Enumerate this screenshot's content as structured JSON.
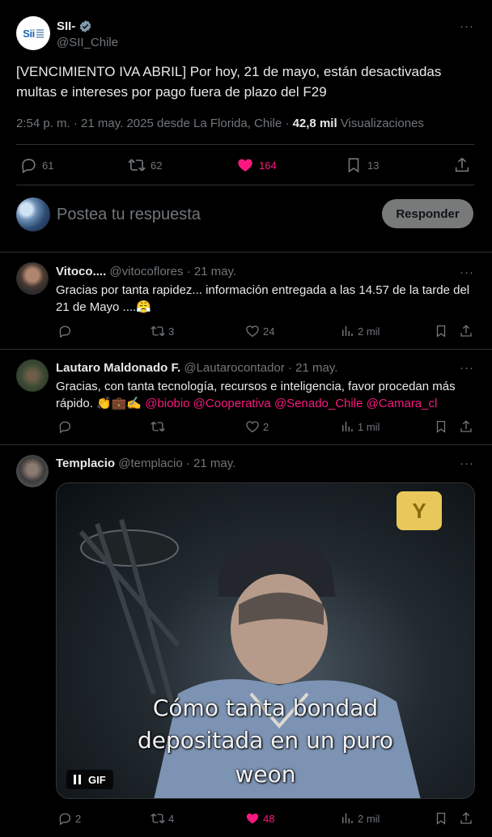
{
  "tweet": {
    "author_name": "SII-",
    "author_handle": "@SII_Chile",
    "logo_text": "Sii",
    "text": "[VENCIMIENTO IVA ABRIL] Por hoy, 21 de mayo, están desactivadas multas e intereses por pago fuera de plazo del F29",
    "meta_time": "2:54 p. m. · 21 may. 2025 desde La Florida, Chile · ",
    "views_count": "42,8 mil",
    "views_label": "Visualizaciones",
    "replies": "61",
    "retweets": "62",
    "likes": "164",
    "bookmarks": "13",
    "more_icon": "···"
  },
  "composer": {
    "placeholder": "Postea tu respuesta",
    "button_label": "Responder"
  },
  "replies": [
    {
      "name": "Vitoco....",
      "handle": "@vitocoflores",
      "date": "· 21 may.",
      "text": "Gracias por tanta rapidez... información entregada a las 14.57 de la tarde del 21 de Mayo ....😤",
      "replies": "",
      "retweets": "3",
      "likes": "24",
      "views": "2 mil"
    },
    {
      "name": "Lautaro Maldonado F.",
      "handle": "@Lautarocontador",
      "date": "· 21 may.",
      "text_plain": "Gracias, con tanta tecnología, recursos e inteligencia, favor procedan más rápido. 👏💼✍️ ",
      "mentions": "@biobio @Cooperativa @Senado_Chile @Camara_cl",
      "replies": "",
      "retweets": "",
      "likes": "2",
      "views": "1 mil"
    },
    {
      "name": "Templacio",
      "handle": "@templacio",
      "date": "· 21 may.",
      "gif_caption_1": "Cómo tanta bondad",
      "gif_caption_2": "depositada en un puro",
      "gif_caption_3": "weon",
      "gif_badge": "GIF",
      "replies": "2",
      "retweets": "4",
      "likes": "48",
      "views": "2 mil"
    }
  ],
  "colors": {
    "background": "#000000",
    "text": "#e7e9ea",
    "muted": "#71767b",
    "accent_blue": "#1d9bf0",
    "like_pink": "#f91880",
    "border": "#2f3336"
  }
}
